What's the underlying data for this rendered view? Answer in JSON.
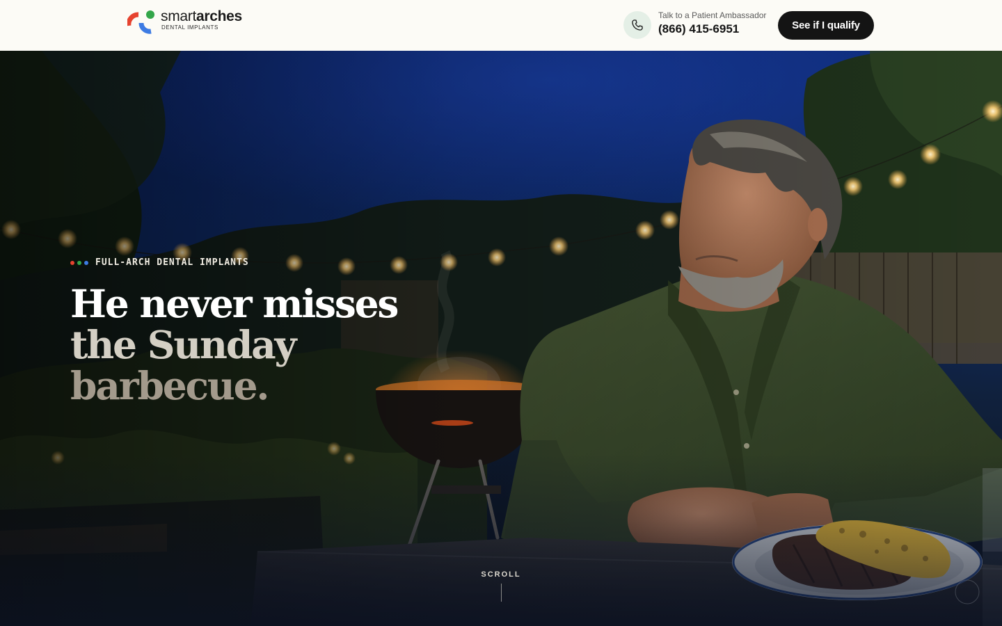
{
  "header": {
    "brand": {
      "name_light": "smart",
      "name_bold": "arches",
      "tagline": "DENTAL IMPLANTS"
    },
    "contact": {
      "label": "Talk to a Patient Ambassador",
      "phone": "(866) 415-6951",
      "icon": "phone-icon"
    },
    "cta_label": "See if I qualify"
  },
  "hero": {
    "eyebrow": "FULL-ARCH DENTAL IMPLANTS",
    "headline": [
      "He never misses",
      "the Sunday",
      "barbecue."
    ],
    "scroll_label": "SCROLL"
  },
  "colors": {
    "brand_red": "#e6432f",
    "brand_green": "#33a64a",
    "brand_blue": "#3d7be3",
    "cta_bg": "#141414",
    "header_bg": "#fcfbf6"
  }
}
